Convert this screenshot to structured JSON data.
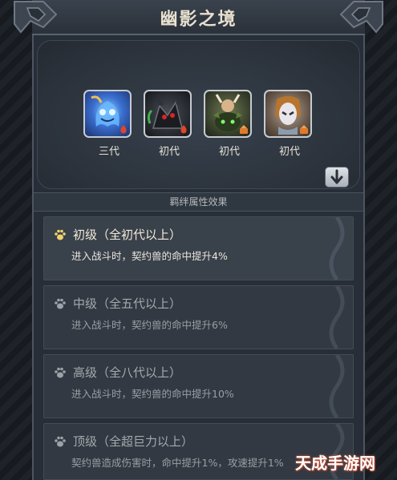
{
  "header": {
    "title": "幽影之境"
  },
  "creatures": [
    {
      "generation": "三代",
      "theme": "blue-ghost",
      "element": "fire"
    },
    {
      "generation": "初代",
      "theme": "dark-dragon",
      "element": "fire"
    },
    {
      "generation": "初代",
      "theme": "moss-beast",
      "element": "earth"
    },
    {
      "generation": "初代",
      "theme": "masked-spirit",
      "element": "earth"
    }
  ],
  "expand_icon": "arrow-down-icon",
  "section": {
    "title": "羁绊属性效果"
  },
  "effects": [
    {
      "title": "初级（全初代以上）",
      "desc": "进入战斗时，契约兽的命中提升4%",
      "active": true
    },
    {
      "title": "中级（全五代以上）",
      "desc": "进入战斗时，契约兽的命中提升6%",
      "active": false
    },
    {
      "title": "高级（全八代以上）",
      "desc": "进入战斗时，契约兽的命中提升10%",
      "active": false
    },
    {
      "title": "顶级（全超巨力以上）",
      "desc": "契约兽造成伤害时，命中提升1%，攻速提升1%",
      "active": false
    }
  ],
  "watermark": "天成手游网",
  "colors": {
    "accent_text": "#f2ead8",
    "inactive_text": "#a6a9ad",
    "fire_badge": "#e0452c",
    "earth_badge": "#e07a2c"
  }
}
